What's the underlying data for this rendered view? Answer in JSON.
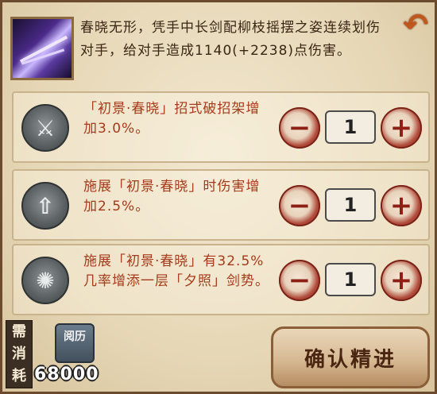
{
  "skill": {
    "icon": "skill-sword-streak-icon",
    "description": "春晓无形，凭手中长剑配柳枝摇摆之姿连续划伤对手，给对手造成1140(+2238)点伤害。"
  },
  "back_button": {
    "icon": "return-arrow-icon",
    "glyph": "↶"
  },
  "rows": [
    {
      "emblem_icon": "sword-emblem-icon",
      "emblem_glyph": "⚔",
      "text": "「初景·春晓」招式破招架增加3.0%。",
      "minus_glyph": "−",
      "count": "1",
      "plus_glyph": "+"
    },
    {
      "emblem_icon": "arrow-emblem-icon",
      "emblem_glyph": "⇧",
      "text": "施展「初景·春晓」时伤害增加2.5%。",
      "minus_glyph": "−",
      "count": "1",
      "plus_glyph": "+"
    },
    {
      "emblem_icon": "swirl-emblem-icon",
      "emblem_glyph": "✺",
      "text": "施展「初景·春晓」有32.5%几率增添一层「夕照」剑势。",
      "minus_glyph": "−",
      "count": "1",
      "plus_glyph": "+"
    }
  ],
  "cost": {
    "label_chars": [
      "需",
      "消",
      "耗"
    ],
    "currency_icon": "book-yueli-icon",
    "currency_label": "阅历",
    "value": "68000"
  },
  "confirm_button": {
    "label": "确认精进"
  },
  "colors": {
    "panel_bg": "#e6d7b6",
    "accent_red": "#a63a1a",
    "button_red": "#8e1f15",
    "border_brown": "#6b4a2e"
  }
}
